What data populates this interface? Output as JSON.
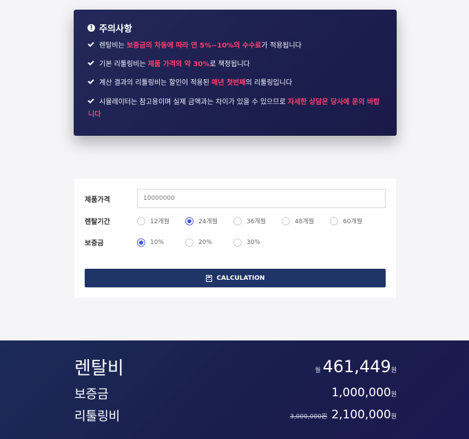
{
  "notice": {
    "title": "주의사항",
    "items": [
      {
        "pre": "렌탈비는 ",
        "hl": "보증금의 차등에 따라 연 5%~10%의 수수료",
        "post": "가 적용됩니다"
      },
      {
        "pre": "기본 리툴링비는 ",
        "hl": "제품 가격의 약 30%",
        "post": "로 책정됩니다"
      },
      {
        "pre": "계산 결과의 리툴링비는 할인이 적용된 ",
        "hl": "매년 첫번째",
        "post": "의 리툴링입니다"
      },
      {
        "pre": "시뮬레이터는 참고용이며 실제 금액과는 차이가 있을 수 있으므로 ",
        "hl": "자세한 상담은 당사에 문의 바랍니다",
        "post": ""
      }
    ]
  },
  "form": {
    "price_label": "제품가격",
    "price_value": "10000000",
    "period_label": "렌탈기간",
    "periods": [
      "12개월",
      "24개월",
      "36개월",
      "48개월",
      "60개월"
    ],
    "period_selected": "24개월",
    "deposit_label": "보증금",
    "deposits": [
      "10%",
      "20%",
      "30%"
    ],
    "deposit_selected": "10%",
    "button_label": "CALCULATION"
  },
  "result": {
    "rental_label": "렌탈비",
    "rental_prefix": "월",
    "rental_value": "461,449",
    "deposit_label": "보증금",
    "deposit_value": "1,000,000",
    "retooling_label": "리툴링비",
    "retooling_original": "3,000,000원",
    "retooling_value": "2,100,000",
    "unit": "원"
  },
  "colors": {
    "notice_bg": "#1f2356",
    "highlight": "#ff3d6e",
    "radio_selected": "#4356d0",
    "button_bg": "#1f3467",
    "result_bg": "#1b2354"
  }
}
